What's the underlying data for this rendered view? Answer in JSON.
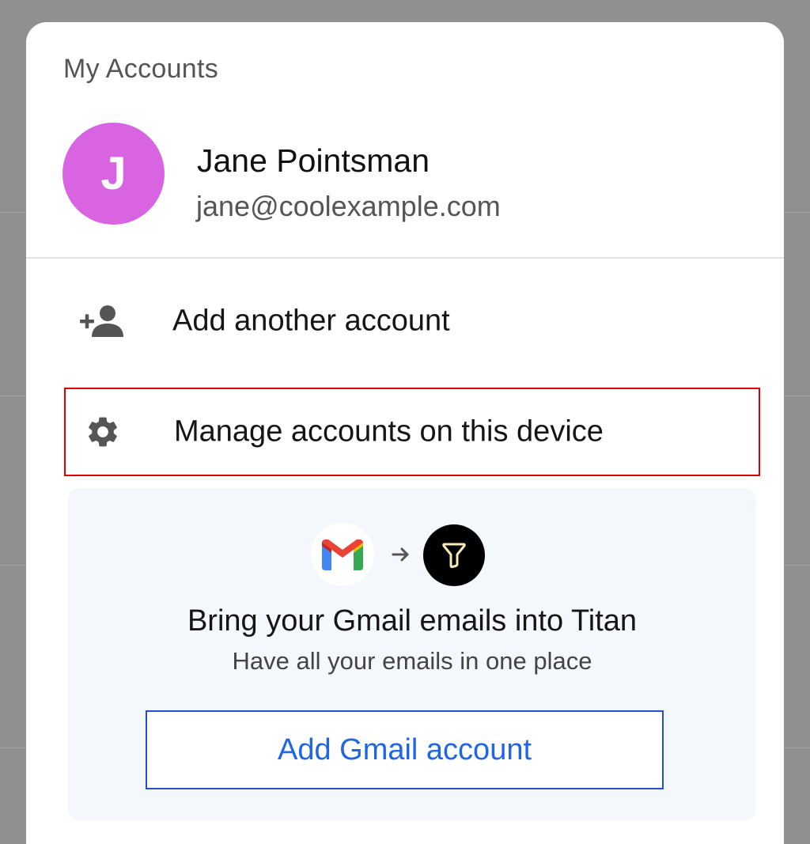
{
  "sheet": {
    "title": "My Accounts"
  },
  "account": {
    "avatar_initial": "J",
    "avatar_color": "#d964e1",
    "name": "Jane Pointsman",
    "email": "jane@coolexample.com"
  },
  "menu": {
    "items": [
      {
        "label": "Add another account",
        "icon": "add-person-icon"
      },
      {
        "label": "Manage accounts on this device",
        "icon": "gear-icon",
        "highlighted": true,
        "highlight_color": "#e00000"
      }
    ]
  },
  "promo": {
    "from_logo": "gmail-logo-icon",
    "arrow": "arrow-right-icon",
    "to_logo": "titan-logo-icon",
    "title": "Bring your Gmail emails into Titan",
    "subtitle": "Have all your emails in one place",
    "button_label": "Add Gmail account",
    "button_color": "#1f66e5",
    "background_color": "#f4f7fc"
  }
}
